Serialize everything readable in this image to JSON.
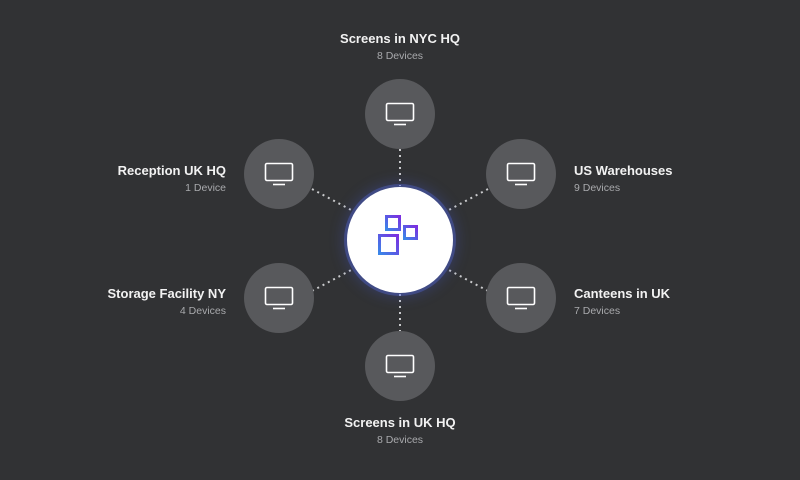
{
  "hub": {
    "icon": "app-logo-icon",
    "gradient": [
      "#3a86e8",
      "#7b2fe0"
    ]
  },
  "groups": {
    "top": {
      "name": "Screens in NYC HQ",
      "count": "8 Devices",
      "icon": "monitor-icon"
    },
    "upper_left": {
      "name": "Reception UK HQ",
      "count": "1 Device",
      "icon": "monitor-icon"
    },
    "upper_right": {
      "name": "US Warehouses",
      "count": "9 Devices",
      "icon": "monitor-icon"
    },
    "lower_left": {
      "name": "Storage Facility NY",
      "count": "4 Devices",
      "icon": "monitor-icon"
    },
    "lower_right": {
      "name": "Canteens in UK",
      "count": "7 Devices",
      "icon": "monitor-icon"
    },
    "bottom": {
      "name": "Screens in UK HQ",
      "count": "8 Devices",
      "icon": "monitor-icon"
    }
  },
  "colors": {
    "background": "#313234",
    "node": "#58595c",
    "connector": "#c9cacc"
  }
}
